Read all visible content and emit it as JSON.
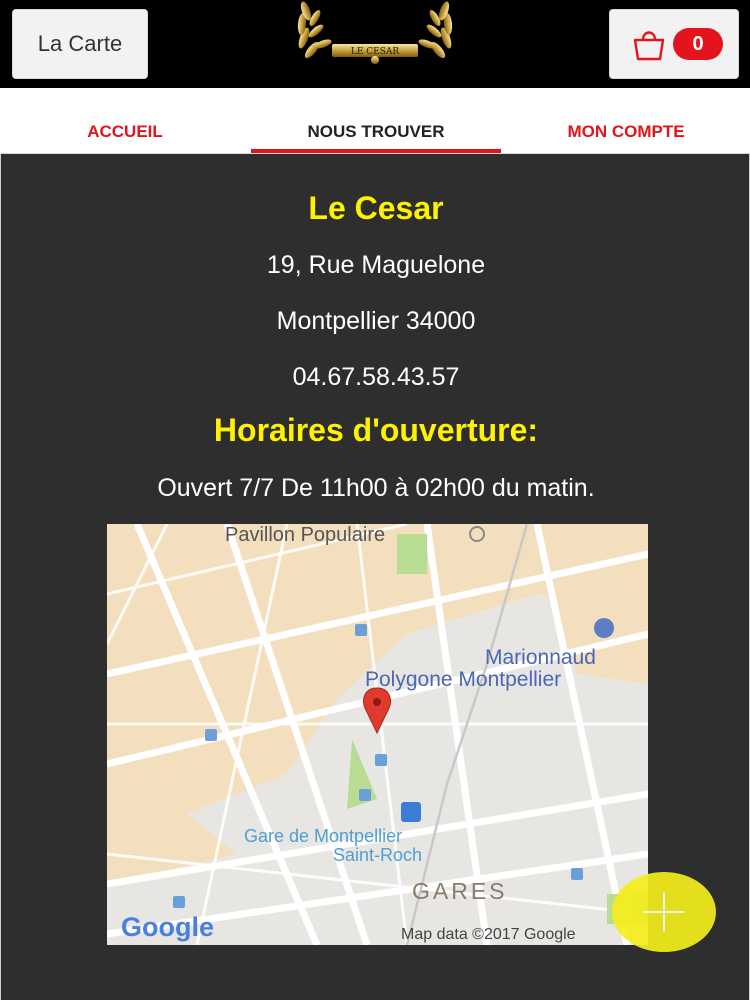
{
  "header": {
    "menu_label": "La Carte",
    "logo_text": "LE CESAR",
    "cart_count": "0"
  },
  "nav": {
    "tabs": [
      {
        "label": "ACCUEIL"
      },
      {
        "label": "NOUS TROUVER"
      },
      {
        "label": "MON COMPTE"
      }
    ]
  },
  "info": {
    "name": "Le Cesar",
    "street": "19, Rue Maguelone",
    "city": "Montpellier 34000",
    "phone": "04.67.58.43.57",
    "hours_title": "Horaires d'ouverture:",
    "hours": "Ouvert 7/7 De 11h00 à 02h00 du matin."
  },
  "map": {
    "labels": {
      "pavillon": "Pavillon Populaire",
      "marionnaud": "Marionnaud",
      "polygone": "Polygone Montpellier",
      "gare1": "Gare de Montpellier",
      "gare2": "Saint-Roch",
      "gares": "GARES",
      "google": "Google",
      "attribution": "Map data ©2017 Google"
    }
  },
  "colors": {
    "accent_red": "#e3141b",
    "accent_yellow": "#fff200",
    "content_bg": "#2e2e2e"
  }
}
